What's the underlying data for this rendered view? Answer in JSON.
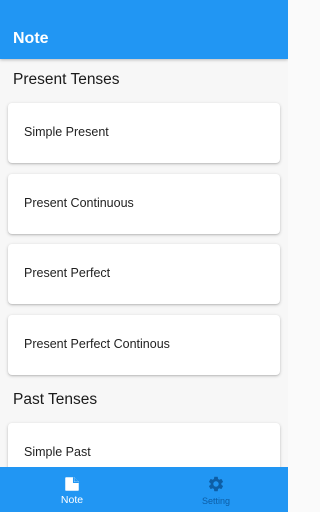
{
  "appbar": {
    "title": "Note"
  },
  "sections": [
    {
      "title": "Present Tenses",
      "items": [
        "Simple Present",
        "Present Continuous",
        "Present Perfect",
        "Present Perfect Continous"
      ]
    },
    {
      "title": "Past Tenses",
      "items": [
        "Simple Past"
      ]
    }
  ],
  "bottom_nav": {
    "items": [
      {
        "label": "Note",
        "icon": "note-icon",
        "active": true
      },
      {
        "label": "Setting",
        "icon": "gear-icon",
        "active": false
      }
    ]
  },
  "colors": {
    "primary": "#2196f3",
    "inactive_nav": "#0d5ea6",
    "background": "#f7f7f7",
    "card": "#ffffff"
  }
}
